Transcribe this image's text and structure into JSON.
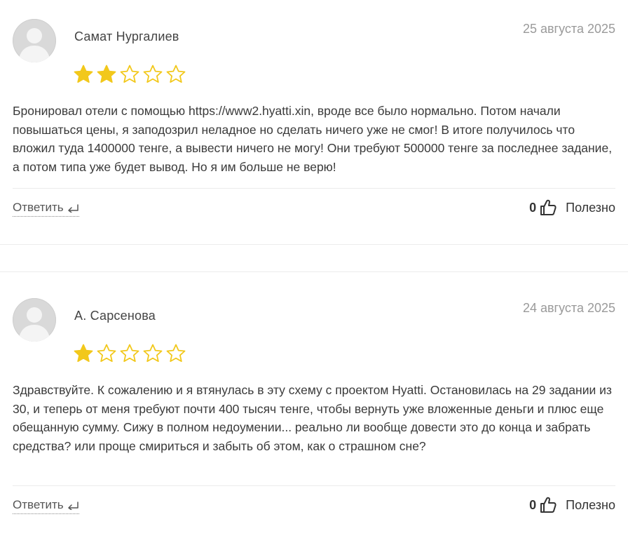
{
  "reviews": [
    {
      "author": "Самат Нургалиев",
      "date": "25 августа 2025",
      "rating": 2,
      "rating_max": 5,
      "text": "Бронировал отели с помощью https://www2.hyatti.xin, вроде все было нормально. Потом начали повышаться цены, я заподозрил неладное но сделать ничего уже не смог! В итоге получилось что вложил туда 1400000 тенге, а вывести ничего не могу! Они требуют 500000 тенге за последнее задание, а потом типа уже будет вывод. Но я им больше не верю!",
      "reply_label": "Ответить",
      "helpful_count": "0",
      "helpful_label": "Полезно"
    },
    {
      "author": "А. Сарсенова",
      "date": "24 августа 2025",
      "rating": 1,
      "rating_max": 5,
      "text": "Здравствуйте. К сожалению и я втянулась в эту схему с проектом Hyatti. Остановилась на 29 задании из 30, и теперь от меня требуют почти 400 тысяч тенге, чтобы вернуть уже вложенные деньги и плюс еще обещанную сумму. Сижу в полном недоумении... реально ли вообще довести это до конца и забрать средства? или проще смириться и забыть об этом, как о страшном сне?",
      "reply_label": "Ответить",
      "helpful_count": "0",
      "helpful_label": "Полезно"
    }
  ],
  "colors": {
    "star_filled": "#f2c81b",
    "star_outline": "#f2c81b",
    "avatar_bg": "#d9d9d9",
    "avatar_fg": "#f4f4f4"
  },
  "icons": {
    "avatar": "default-user-avatar",
    "star": "star-icon",
    "reply": "reply-arrow-icon",
    "thumb": "thumbs-up-icon"
  }
}
